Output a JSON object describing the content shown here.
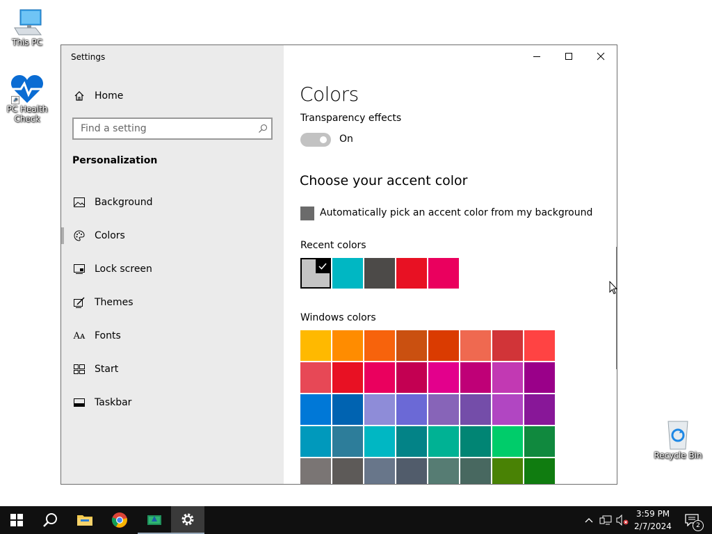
{
  "desktop": {
    "this_pc_label": "This PC",
    "pc_health_label": "PC Health Check",
    "recycle_bin_label": "Recycle Bin"
  },
  "window": {
    "title": "Settings"
  },
  "sidebar": {
    "home_label": "Home",
    "search_placeholder": "Find a setting",
    "section_title": "Personalization",
    "items": [
      {
        "label": "Background",
        "icon": "image-icon"
      },
      {
        "label": "Colors",
        "icon": "palette-icon",
        "selected": true
      },
      {
        "label": "Lock screen",
        "icon": "lock-screen-icon"
      },
      {
        "label": "Themes",
        "icon": "themes-icon"
      },
      {
        "label": "Fonts",
        "icon": "fonts-icon"
      },
      {
        "label": "Start",
        "icon": "start-icon"
      },
      {
        "label": "Taskbar",
        "icon": "taskbar-icon"
      }
    ]
  },
  "content": {
    "page_title": "Colors",
    "transparency_label": "Transparency effects",
    "transparency_state": "On",
    "accent_heading": "Choose your accent color",
    "auto_pick_label": "Automatically pick an accent color from my background",
    "recent_label": "Recent colors",
    "recent_colors": [
      "#c4c4c4",
      "#00b7c3",
      "#4c4a48",
      "#e81123",
      "#ea005e"
    ],
    "windows_label": "Windows colors",
    "windows_colors": [
      "#ffb900",
      "#ff8c00",
      "#f7630c",
      "#ca5010",
      "#da3b01",
      "#ef6950",
      "#d13438",
      "#ff4343",
      "#e74856",
      "#e81123",
      "#ea005e",
      "#c30052",
      "#e3008c",
      "#bf0077",
      "#c239b3",
      "#9a0089",
      "#0078d7",
      "#0063b1",
      "#8e8cd8",
      "#6b69d6",
      "#8764b8",
      "#744da9",
      "#b146c2",
      "#881798",
      "#0099bc",
      "#2d7d9a",
      "#00b7c3",
      "#038387",
      "#00b294",
      "#018574",
      "#00cc6a",
      "#10893e",
      "#7a7574",
      "#5d5a58",
      "#68768a",
      "#515c6b",
      "#567c73",
      "#486860",
      "#498205",
      "#107c10"
    ]
  },
  "taskbar": {
    "time": "3:59 PM",
    "date": "2/7/2024",
    "notification_count": "2"
  }
}
